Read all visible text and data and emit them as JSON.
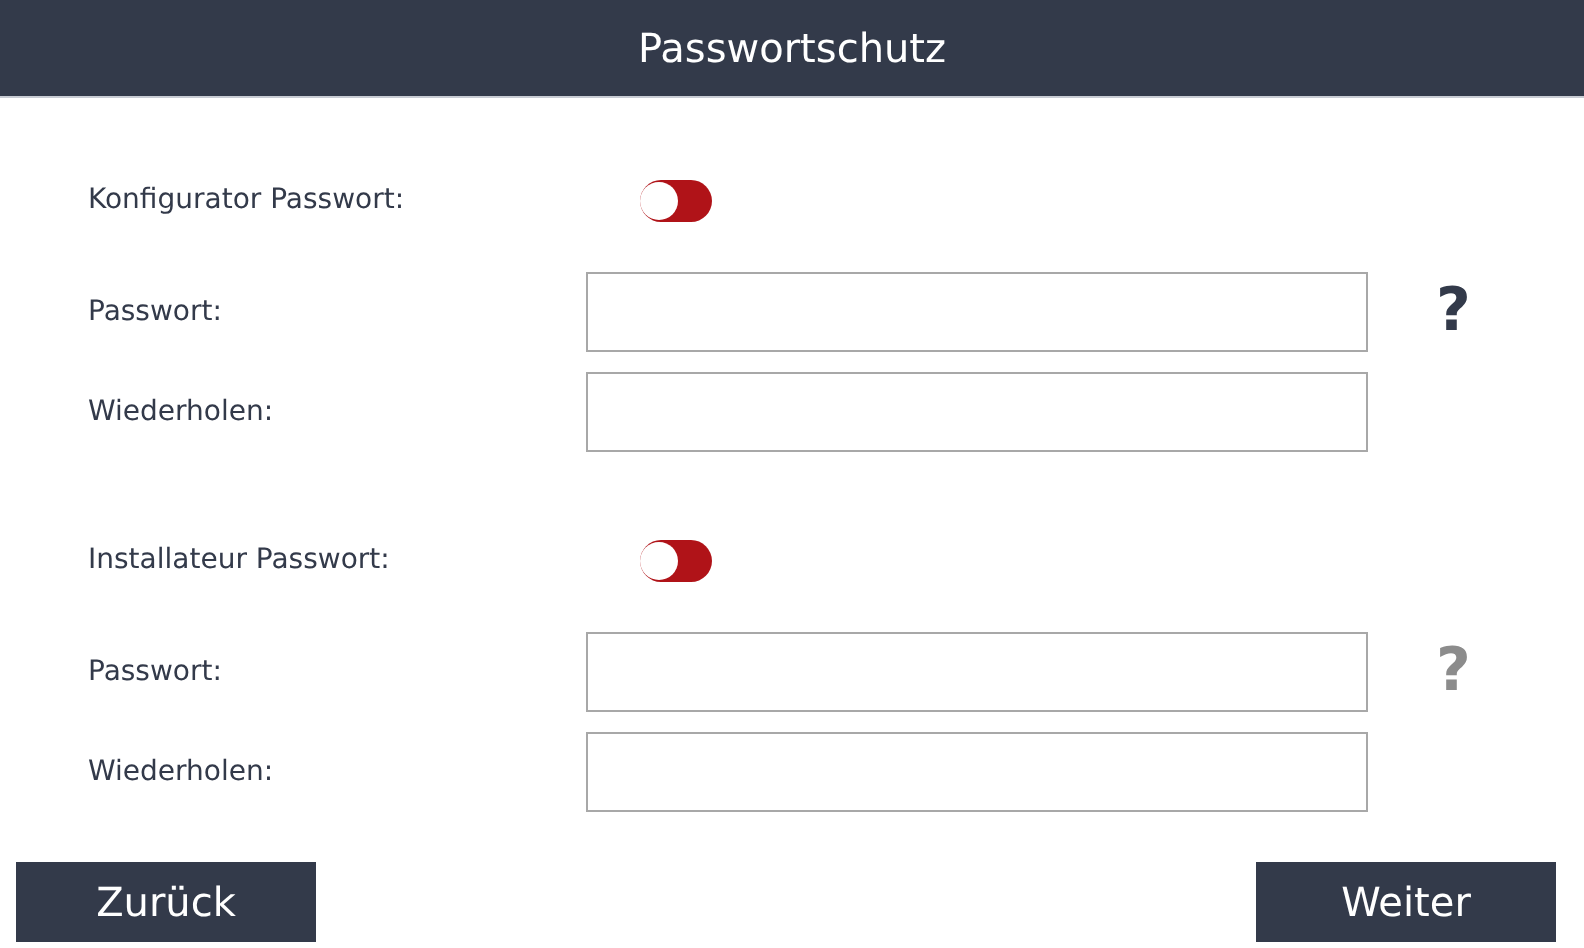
{
  "window": {
    "title": "Passwortschutz"
  },
  "sections": [
    {
      "toggle": {
        "label": "Konfigurator Passwort:",
        "on": false
      },
      "fields": [
        {
          "label": "Passwort:"
        },
        {
          "label": "Wiederholen:"
        }
      ],
      "help": {
        "text": "?",
        "disabled": false
      }
    },
    {
      "toggle": {
        "label": "Installateur Passwort:",
        "on": false
      },
      "fields": [
        {
          "label": "Passwort:"
        },
        {
          "label": "Wiederholen:"
        }
      ],
      "help": {
        "text": "?",
        "disabled": true
      }
    }
  ],
  "buttons": [
    {
      "label": "Zurück"
    },
    {
      "label": "Weiter"
    }
  ]
}
